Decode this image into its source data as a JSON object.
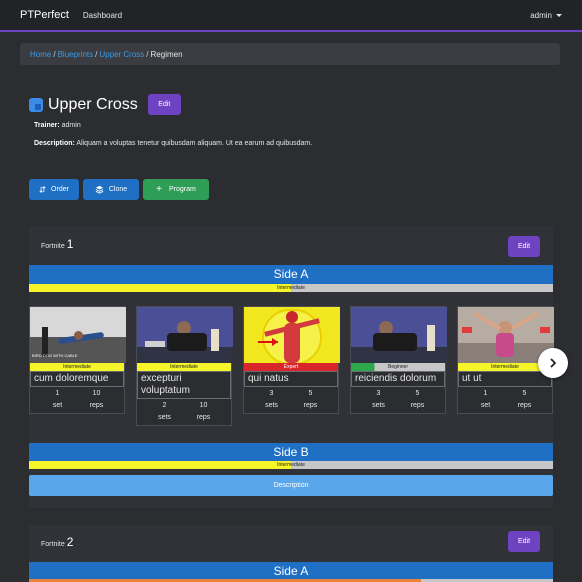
{
  "nav": {
    "brand": "PTPerfect",
    "dashboard": "Dashboard",
    "user": "admin"
  },
  "breadcrumb": {
    "home": "Home",
    "blueprints": "Blueprints",
    "upper_cross": "Upper Cross",
    "current": "Regimen"
  },
  "header": {
    "title": "Upper Cross",
    "edit_label": "Edit"
  },
  "info": {
    "trainer_label": "Trainer:",
    "trainer_value": "admin",
    "description_label": "Description:",
    "description_value": "Aliquam a voluptas tenetur quibusdam aliquam. Ut ea earum ad quibusdam."
  },
  "actions": {
    "order": "Order",
    "clone": "Clone",
    "program": "Program"
  },
  "fortnite1": {
    "label": "Fortnite",
    "number": "1",
    "edit": "Edit"
  },
  "sideA": {
    "title": "Side A",
    "level": "Intermediate"
  },
  "sideB": {
    "title": "Side B",
    "level": "Intermediate",
    "description": "Description"
  },
  "fortnite2": {
    "label": "Fortnite",
    "number": "2",
    "edit": "Edit"
  },
  "sideA2": {
    "title": "Side A"
  },
  "cards": [
    {
      "level": "Intermediate",
      "level_color": "#f5f52a",
      "name": "cum doloremque",
      "v1": "1",
      "l1": "set",
      "v2": "10",
      "l2": "reps",
      "thumb_text": "BIRD-DOG WITH CABLE"
    },
    {
      "level": "Intermediate",
      "level_color": "#f5f52a",
      "name": "excepturi voluptatum",
      "v1": "2",
      "l1": "sets",
      "v2": "10",
      "l2": "reps"
    },
    {
      "level": "Expert",
      "level_color": "#d9262b",
      "name": "qui natus",
      "v1": "3",
      "l1": "sets",
      "v2": "5",
      "l2": "reps"
    },
    {
      "level": "Beginner",
      "level_color": "#2ea84a",
      "name": "reiciendis dolorum",
      "v1": "3",
      "l1": "sets",
      "v2": "5",
      "l2": "reps"
    },
    {
      "level": "Intermediate",
      "level_color": "#f5f52a",
      "name": "ut ut",
      "v1": "1",
      "l1": "set",
      "v2": "5",
      "l2": "reps"
    }
  ],
  "colors": {
    "accent": "#6f42c1",
    "primary": "#1f6fc5",
    "success": "#2e9e57",
    "link": "#3b9ae1"
  }
}
